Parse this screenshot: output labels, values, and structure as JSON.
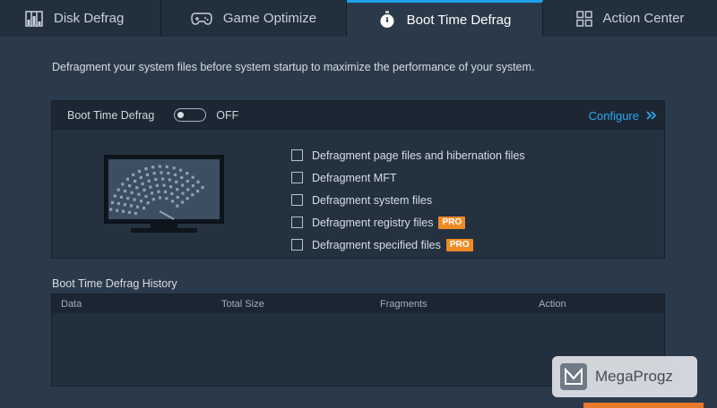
{
  "tabs": [
    {
      "label": "Disk Defrag",
      "icon": "disk-defrag-icon"
    },
    {
      "label": "Game Optimize",
      "icon": "gamepad-icon"
    },
    {
      "label": "Boot Time Defrag",
      "icon": "stopwatch-icon",
      "active": true
    },
    {
      "label": "Action Center",
      "icon": "grid-icon"
    }
  ],
  "description": "Defragment your system files before system startup to maximize the performance of your system.",
  "panel": {
    "title": "Boot Time Defrag",
    "toggle_state": "OFF",
    "configure_label": "Configure",
    "options": [
      {
        "label": "Defragment page files and hibernation files",
        "checked": false
      },
      {
        "label": "Defragment MFT",
        "checked": false
      },
      {
        "label": "Defragment system files",
        "checked": false
      },
      {
        "label": "Defragment registry files",
        "checked": false,
        "badge": "PRO"
      },
      {
        "label": "Defragment specified files",
        "checked": false,
        "badge": "PRO"
      }
    ]
  },
  "history": {
    "title": "Boot Time Defrag History",
    "columns": [
      "Data",
      "Total Size",
      "Fragments",
      "Action"
    ]
  },
  "watermark": {
    "text": "MegaProgz"
  },
  "colors": {
    "accent": "#1ea1e8",
    "pro_badge": "#f08a24",
    "background": "#2b3a4a"
  }
}
